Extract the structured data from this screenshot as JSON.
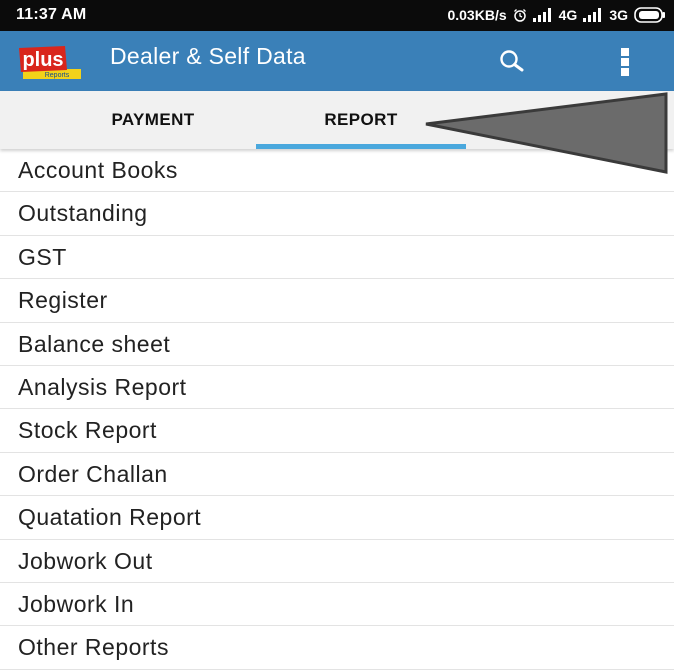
{
  "status_bar": {
    "time": "11:37 AM",
    "speed": "0.03KB/s",
    "network_1": "4G",
    "network_2": "3G"
  },
  "app_bar": {
    "logo_text": "plus",
    "logo_subtext": "Reports",
    "title": "Dealer & Self Data",
    "search_icon": "search-icon",
    "more_icon": "more-vertical-icon",
    "color": "#3a80b8"
  },
  "tabs": [
    {
      "label": "PAYMENT",
      "selected": false
    },
    {
      "label": "REPORT",
      "selected": true
    }
  ],
  "tab_indicator_color": "#4aa8dd",
  "menu": {
    "items": [
      {
        "label": "Account Books"
      },
      {
        "label": "Outstanding"
      },
      {
        "label": "GST"
      },
      {
        "label": "Register"
      },
      {
        "label": "Balance sheet"
      },
      {
        "label": "Analysis Report"
      },
      {
        "label": "Stock Report"
      },
      {
        "label": "Order Challan"
      },
      {
        "label": "Quatation Report"
      },
      {
        "label": "Jobwork Out"
      },
      {
        "label": "Jobwork In"
      },
      {
        "label": "Other Reports"
      }
    ]
  }
}
